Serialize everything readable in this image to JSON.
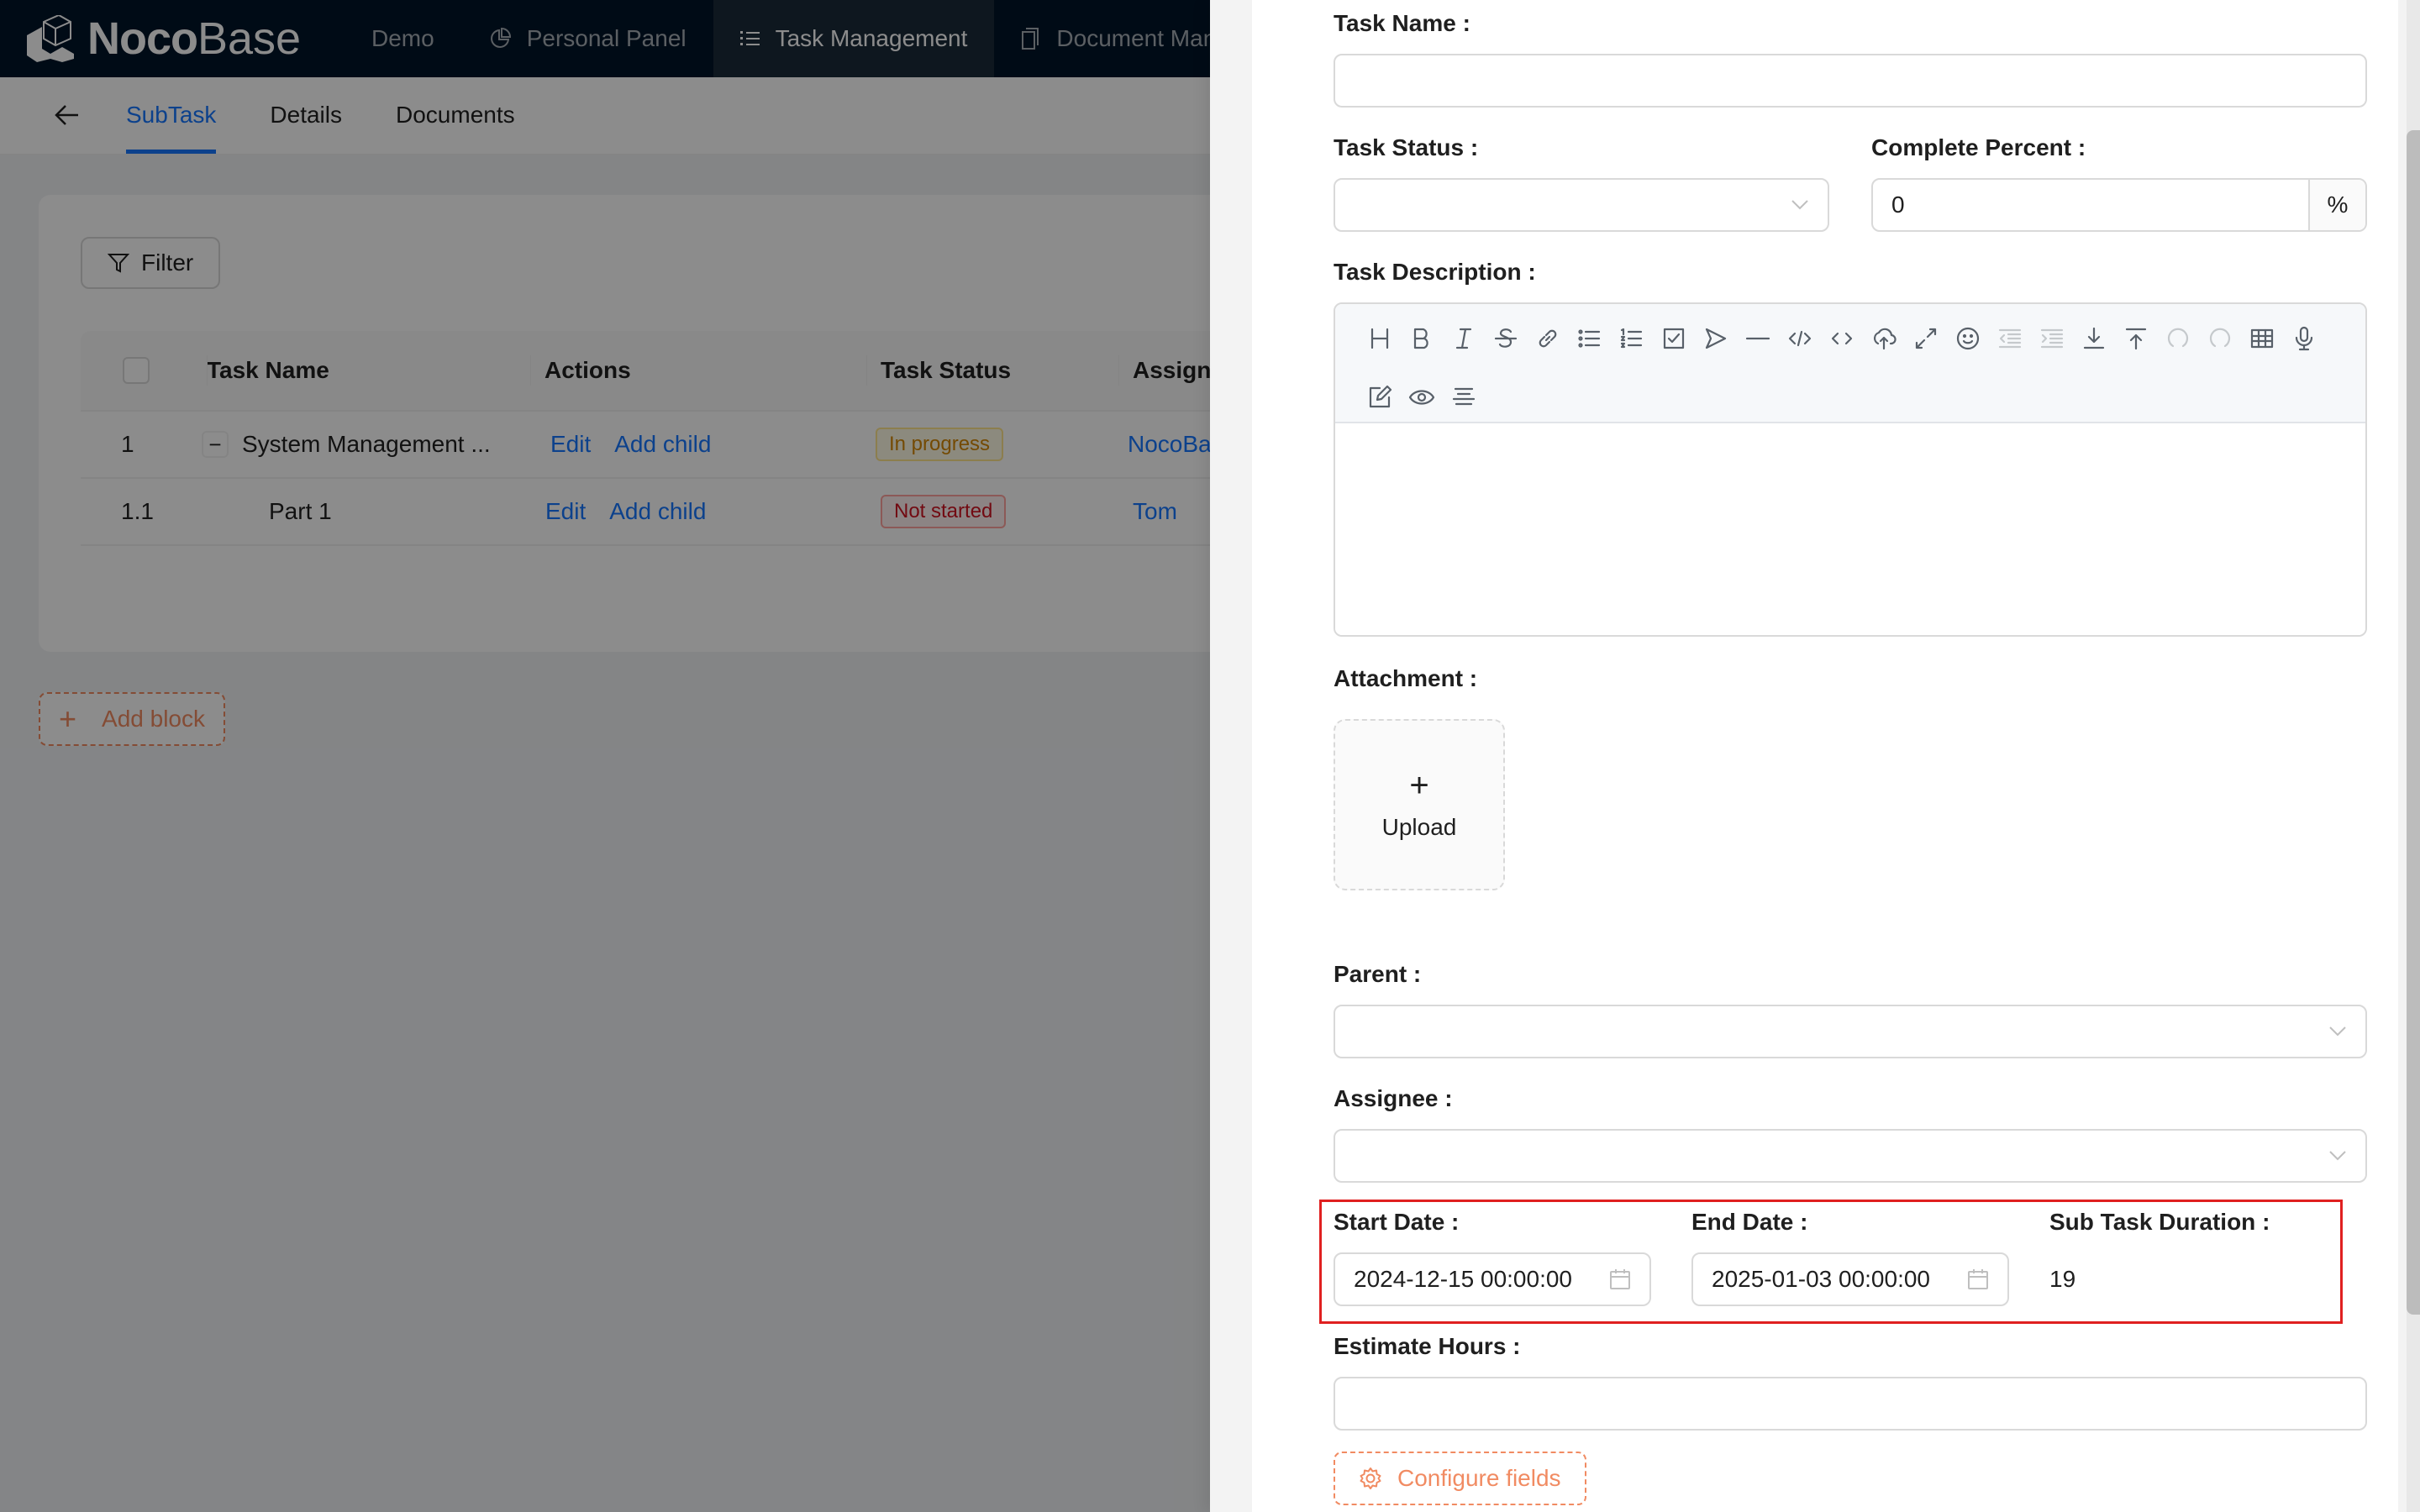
{
  "app": {
    "brand_bold": "Noco",
    "brand_light": "Base"
  },
  "topnav": {
    "items": [
      {
        "label": "Demo",
        "icon": "none",
        "active": false
      },
      {
        "label": "Personal Panel",
        "icon": "pie-chart-icon",
        "active": false
      },
      {
        "label": "Task Management",
        "icon": "list-icon",
        "active": true
      },
      {
        "label": "Document Mana",
        "icon": "document-icon",
        "active": false
      }
    ]
  },
  "subheader": {
    "back_icon": "arrow-left-icon",
    "tabs": [
      {
        "label": "SubTask",
        "active": true
      },
      {
        "label": "Details",
        "active": false
      },
      {
        "label": "Documents",
        "active": false
      }
    ]
  },
  "table_block": {
    "filter_label": "Filter",
    "columns": [
      "Task Name",
      "Actions",
      "Task Status",
      "Assignee"
    ],
    "rows": [
      {
        "index": "1",
        "task_name": "System Management ...",
        "expandable": true,
        "expand_symbol": "−",
        "actions": [
          "Edit",
          "Add child"
        ],
        "status": "In progress",
        "status_kind": "progress",
        "assignee": "NocoBase"
      },
      {
        "index": "1.1",
        "task_name": "Part 1",
        "expandable": false,
        "expand_symbol": "",
        "actions": [
          "Edit",
          "Add child"
        ],
        "status": "Not started",
        "status_kind": "notstarted",
        "assignee": "Tom"
      }
    ]
  },
  "add_block": {
    "label": "Add block",
    "icon": "+"
  },
  "form": {
    "task_name": {
      "label": "Task Name :",
      "value": ""
    },
    "task_status": {
      "label": "Task Status :",
      "value": ""
    },
    "complete_percent": {
      "label": "Complete Percent :",
      "value": "0",
      "suffix": "%"
    },
    "task_description": {
      "label": "Task Description :",
      "toolbar": [
        {
          "name": "heading-icon",
          "enabled": true
        },
        {
          "name": "bold-icon",
          "enabled": true
        },
        {
          "name": "italic-icon",
          "enabled": true
        },
        {
          "name": "strikethrough-icon",
          "enabled": true
        },
        {
          "name": "link-icon",
          "enabled": true
        },
        {
          "name": "bullet-list-icon",
          "enabled": true
        },
        {
          "name": "ordered-list-icon",
          "enabled": true
        },
        {
          "name": "checklist-icon",
          "enabled": true
        },
        {
          "name": "quote-icon",
          "enabled": true
        },
        {
          "name": "horizontal-line-icon",
          "enabled": true
        },
        {
          "name": "code-block-icon",
          "enabled": true
        },
        {
          "name": "inline-code-icon",
          "enabled": true
        },
        {
          "name": "upload-icon",
          "enabled": true
        },
        {
          "name": "fullscreen-icon",
          "enabled": true
        },
        {
          "name": "emoji-icon",
          "enabled": true
        },
        {
          "name": "outdent-icon",
          "enabled": false
        },
        {
          "name": "indent-icon",
          "enabled": false
        },
        {
          "name": "insert-after-icon",
          "enabled": true
        },
        {
          "name": "insert-before-icon",
          "enabled": true
        },
        {
          "name": "undo-icon",
          "enabled": false
        },
        {
          "name": "redo-icon",
          "enabled": false
        },
        {
          "name": "table-icon",
          "enabled": true
        },
        {
          "name": "record-icon",
          "enabled": true
        },
        {
          "name": "edit-mode-icon",
          "enabled": true
        },
        {
          "name": "preview-icon",
          "enabled": true
        },
        {
          "name": "align-center-icon",
          "enabled": true
        }
      ],
      "value": ""
    },
    "attachment": {
      "label": "Attachment :",
      "upload_label": "Upload"
    },
    "parent": {
      "label": "Parent :",
      "value": ""
    },
    "assignee": {
      "label": "Assignee :",
      "value": ""
    },
    "start_date": {
      "label": "Start Date :",
      "value": "2024-12-15 00:00:00"
    },
    "end_date": {
      "label": "End Date :",
      "value": "2025-01-03 00:00:00"
    },
    "sub_task_duration": {
      "label": "Sub Task Duration :",
      "value": "19"
    },
    "estimate_hours": {
      "label": "Estimate Hours :",
      "value": ""
    },
    "configure_fields_label": "Configure fields"
  },
  "colors": {
    "primary": "#1677ff",
    "nav_bg": "#001529",
    "accent_dashed": "#f18b62",
    "highlight_border": "#e02020"
  }
}
